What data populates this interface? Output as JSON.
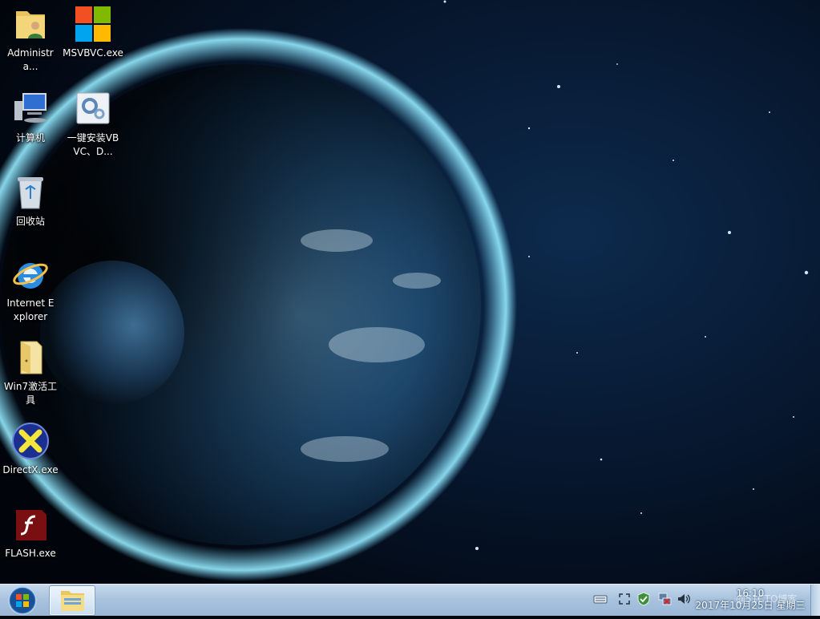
{
  "desktop": {
    "icons": [
      {
        "label": "Administra...",
        "icon": "user-folder-icon"
      },
      {
        "label": "MSVBVC.exe",
        "icon": "windows-logo-icon"
      },
      {
        "label": "计算机",
        "icon": "computer-icon"
      },
      {
        "label": "一键安装VBVC、D...",
        "icon": "installer-gear-icon"
      },
      {
        "label": "回收站",
        "icon": "recycle-bin-icon"
      },
      {
        "label": "Internet Explorer",
        "icon": "internet-explorer-icon"
      },
      {
        "label": "Win7激活工具",
        "icon": "folder-icon"
      },
      {
        "label": "DirectX.exe",
        "icon": "directx-icon"
      },
      {
        "label": "FLASH.exe",
        "icon": "flash-player-icon"
      }
    ]
  },
  "taskbar": {
    "start_icon": "windows-start-orb-icon",
    "pinned_icon": "windows-explorer-icon",
    "tray_icons": [
      "keyboard-icon",
      "fullscreen-icon",
      "security-shield-icon",
      "network-icon",
      "volume-icon"
    ],
    "clock_time": "16:10",
    "clock_date": "2017年10月25日 星期三"
  },
  "watermark": "@51CTO博客",
  "colors": {
    "accent": "#1c6bd6",
    "taskbar": "#a9c3de"
  }
}
